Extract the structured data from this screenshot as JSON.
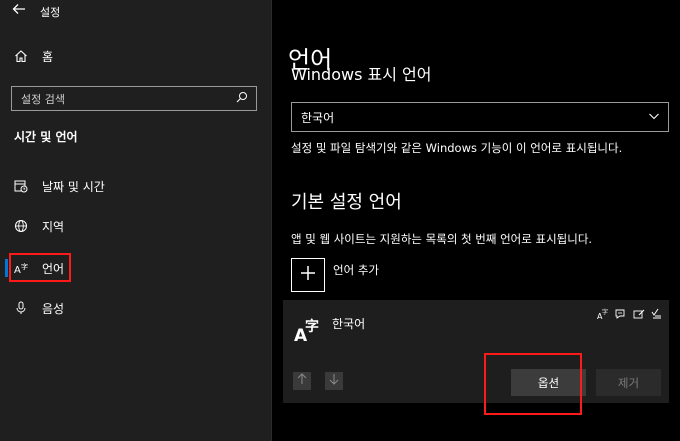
{
  "window": {
    "app_title": "설정"
  },
  "sidebar": {
    "home_label": "홈",
    "search_placeholder": "설정 검색",
    "section_heading": "시간 및 언어",
    "items": [
      {
        "label": "날짜 및 시간",
        "icon": "calendar-clock-icon"
      },
      {
        "label": "지역",
        "icon": "globe-icon"
      },
      {
        "label": "언어",
        "icon": "language-icon",
        "active": true
      },
      {
        "label": "음성",
        "icon": "microphone-icon"
      }
    ]
  },
  "main": {
    "page_title": "언어",
    "windows_display_heading": "Windows 표시 언어",
    "display_language_value": "한국어",
    "display_language_desc": "설정 및 파일 탐색기와 같은 Windows 기능이 이 언어로 표시됩니다.",
    "preferred_heading": "기본 설정 언어",
    "preferred_desc": "앱 및 웹 사이트는 지원하는 목록의 첫 번째 언어로 표시됩니다.",
    "add_language_label": "언어 추가",
    "language_card": {
      "glyph": "A字",
      "name": "한국어",
      "options_label": "옵션",
      "remove_label": "제거"
    }
  },
  "colors": {
    "accent": "#0078d7",
    "highlight": "#ff1a1a",
    "sidebar_bg": "#1f1f1f",
    "main_bg": "#000000"
  }
}
